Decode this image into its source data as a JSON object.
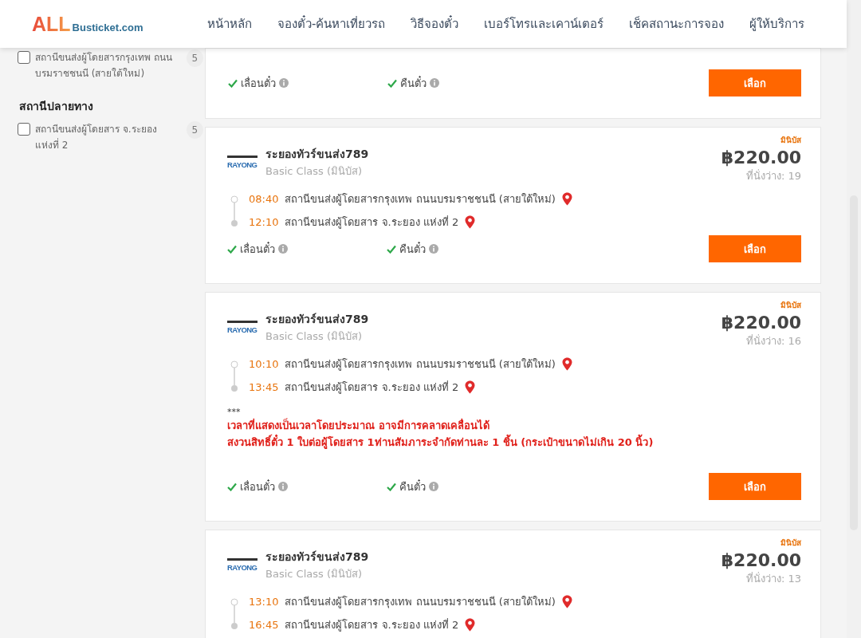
{
  "header": {
    "logo": {
      "primary": "ALL",
      "secondary": "Busticket.com"
    },
    "nav": [
      "หน้าหลัก",
      "จองตั๋ว-ค้นหาเที่ยวรถ",
      "วิธีจองตั๋ว",
      "เบอร์โทรและเคาน์เตอร์",
      "เช็คสถานะการจอง",
      "ผู้ให้บริการ"
    ]
  },
  "sidebar": {
    "origin_items": [
      {
        "label": "สถานีขนส่งผู้โดยสารกรุงเทพ ถนนบรมราชชนนี (สายใต้ใหม่)",
        "count": "5",
        "checked": false
      }
    ],
    "destination": {
      "title": "สถานีปลายทาง",
      "items": [
        {
          "label": "สถานีขนส่งผู้โดยสาร จ.ระยอง แห่งที่ 2",
          "count": "5",
          "checked": false
        }
      ]
    }
  },
  "trips": [
    {
      "features": [
        {
          "label": "เลื่อนตั๋ว",
          "available": true
        },
        {
          "label": "คืนตั๋ว",
          "available": true
        }
      ],
      "button": "เลือก"
    },
    {
      "badge": "มินิบัส",
      "operator": "ระยองทัวร์ขนส่ง789",
      "operator_logo": "RAYONG",
      "bus_class": "Basic Class (มินิบัส)",
      "price": "฿220.00",
      "seats": "ที่นั่งว่าง: 19",
      "stops": [
        {
          "time": "08:40",
          "station": "สถานีขนส่งผู้โดยสารกรุงเทพ ถนนบรมราชชนนี (สายใต้ใหม่)"
        },
        {
          "time": "12:10",
          "station": "สถานีขนส่งผู้โดยสาร จ.ระยอง แห่งที่ 2"
        }
      ],
      "features": [
        {
          "label": "เลื่อนตั๋ว",
          "available": true
        },
        {
          "label": "คืนตั๋ว",
          "available": true
        }
      ],
      "button": "เลือก"
    },
    {
      "badge": "มินิบัส",
      "operator": "ระยองทัวร์ขนส่ง789",
      "operator_logo": "RAYONG",
      "bus_class": "Basic Class (มินิบัส)",
      "price": "฿220.00",
      "seats": "ที่นั่งว่าง: 16",
      "stops": [
        {
          "time": "10:10",
          "station": "สถานีขนส่งผู้โดยสารกรุงเทพ ถนนบรมราชชนนี (สายใต้ใหม่)"
        },
        {
          "time": "13:45",
          "station": "สถานีขนส่งผู้โดยสาร จ.ระยอง แห่งที่ 2"
        }
      ],
      "note": {
        "marker": "***",
        "lines": [
          "เวลาที่แสดงเป็นเวลาโดยประมาณ อาจมีการคลาดเคลื่อนได้",
          "สงวนสิทธิ์ตั๋ว 1 ใบต่อผู้โดยสาร 1ท่านสัมภาระจำกัดท่านละ 1 ชิ้น (กระเป๋าขนาดไม่เกิน 20 นิ้ว)"
        ]
      },
      "features": [
        {
          "label": "เลื่อนตั๋ว",
          "available": true
        },
        {
          "label": "คืนตั๋ว",
          "available": true
        }
      ],
      "button": "เลือก"
    },
    {
      "badge": "มินิบัส",
      "operator": "ระยองทัวร์ขนส่ง789",
      "operator_logo": "RAYONG",
      "bus_class": "Basic Class (มินิบัส)",
      "price": "฿220.00",
      "seats": "ที่นั่งว่าง: 13",
      "stops": [
        {
          "time": "13:10",
          "station": "สถานีขนส่งผู้โดยสารกรุงเทพ ถนนบรมราชชนนี (สายใต้ใหม่)"
        },
        {
          "time": "16:45",
          "station": "สถานีขนส่งผู้โดยสาร จ.ระยอง แห่งที่ 2"
        }
      ]
    }
  ]
}
